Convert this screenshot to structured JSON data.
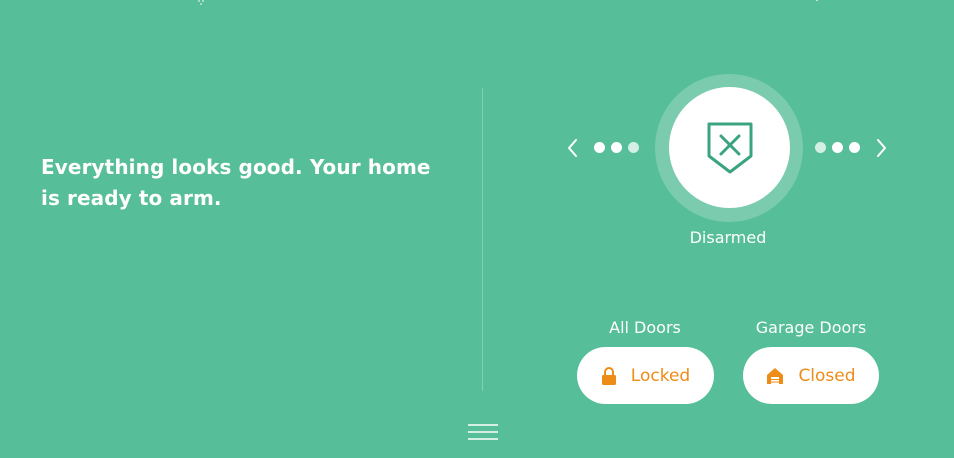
{
  "status": {
    "message": "Everything looks good. Your home is ready to arm."
  },
  "security": {
    "mode_label": "Disarmed",
    "mode_icon": "shield-x-icon"
  },
  "locks": [
    {
      "label": "All Doors",
      "state": "Locked",
      "icon": "padlock-icon"
    },
    {
      "label": "Garage Doors",
      "state": "Closed",
      "icon": "garage-icon"
    }
  ],
  "colors": {
    "background": "#56be99",
    "accent": "#ee8c18",
    "shield": "#3aa47f"
  }
}
